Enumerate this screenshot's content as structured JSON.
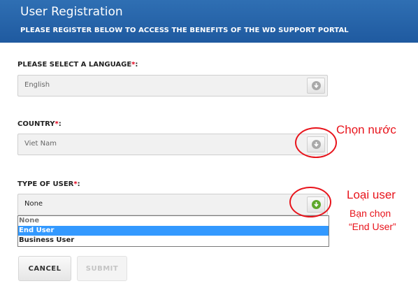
{
  "header": {
    "title": "User Registration",
    "subtitle": "PLEASE REGISTER BELOW TO ACCESS THE BENEFITS OF THE WD SUPPORT PORTAL"
  },
  "form": {
    "language": {
      "label": "PLEASE SELECT A LANGUAGE",
      "required_mark": "*",
      "colon": ":",
      "value": "English"
    },
    "country": {
      "label": "COUNTRY",
      "required_mark": "*",
      "colon": ":",
      "value": "Viet Nam"
    },
    "user_type": {
      "label": "TYPE OF USER",
      "required_mark": "*",
      "colon": ":",
      "value": "None",
      "options": [
        "None",
        "End User",
        "Business User"
      ],
      "highlighted_option": "End User"
    }
  },
  "buttons": {
    "cancel": "CANCEL",
    "submit": "SUBMIT"
  },
  "annotations": {
    "country_note": "Chọn nước",
    "user_type_note": "Loại user",
    "choose_note_line1": "Bạn chọn",
    "choose_note_line2": "“End User”"
  },
  "colors": {
    "header_blue": "#2568ad",
    "required_red": "#e0001a",
    "annotation_red": "#e8141c",
    "selected_blue": "#3399ff",
    "active_arrow_green": "#5fa82c"
  },
  "icons": {
    "select_arrow": "down-arrow-circle-icon"
  }
}
